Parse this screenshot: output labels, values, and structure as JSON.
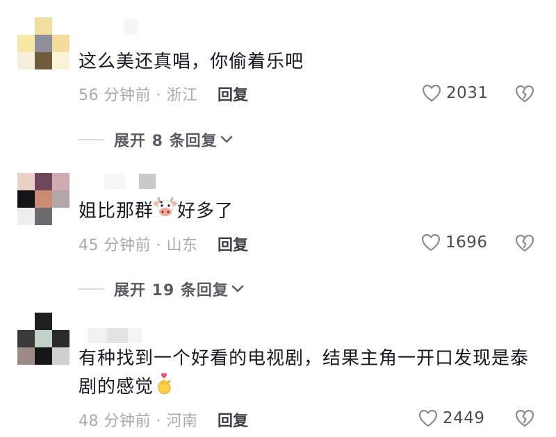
{
  "comments": [
    {
      "avatar_colors": [
        "#ffffff",
        "#f2dfa0",
        "#ffffff",
        "#f7e8a8",
        "#8f8f99",
        "#f4dd9c",
        "#f6efe0",
        "#6e5b3c",
        "#faf3da"
      ],
      "text": "这么美还真唱，你偷着乐吧",
      "meta": "56 分钟前 · 浙江",
      "reply_label": "回复",
      "likes": "2031",
      "expand_label": "展开 8 条回复"
    },
    {
      "avatar_colors": [
        "#eccfc6",
        "#71485b",
        "#d0acb2",
        "#141416",
        "#c98c72",
        "#b2a7a6",
        "#eeeeee",
        "#6e6b70",
        "#ffffff"
      ],
      "text_before": "姐比那群",
      "text_emoji": "cow-face",
      "text_after": "好多了",
      "meta": "45 分钟前 · 山东",
      "reply_label": "回复",
      "likes": "1696",
      "expand_label": "展开 19 条回复"
    },
    {
      "avatar_colors": [
        "#ffffff",
        "#1f1f1f",
        "#ffffff",
        "#3a3a3a",
        "#c3d2c8",
        "#2a2a2a",
        "#9b8a86",
        "#161616",
        "#cfcfcf"
      ],
      "text": "有种找到一个好看的电视剧，结果主角一开口发现是泰剧的感觉",
      "text_emoji": "heart-hands",
      "meta": "48 分钟前 · 河南",
      "reply_label": "回复",
      "likes": "2449"
    }
  ],
  "colors": {
    "text": "#161823",
    "meta": "#a9a9b0",
    "reply": "#3f4149",
    "icon": "#8a8b91"
  }
}
